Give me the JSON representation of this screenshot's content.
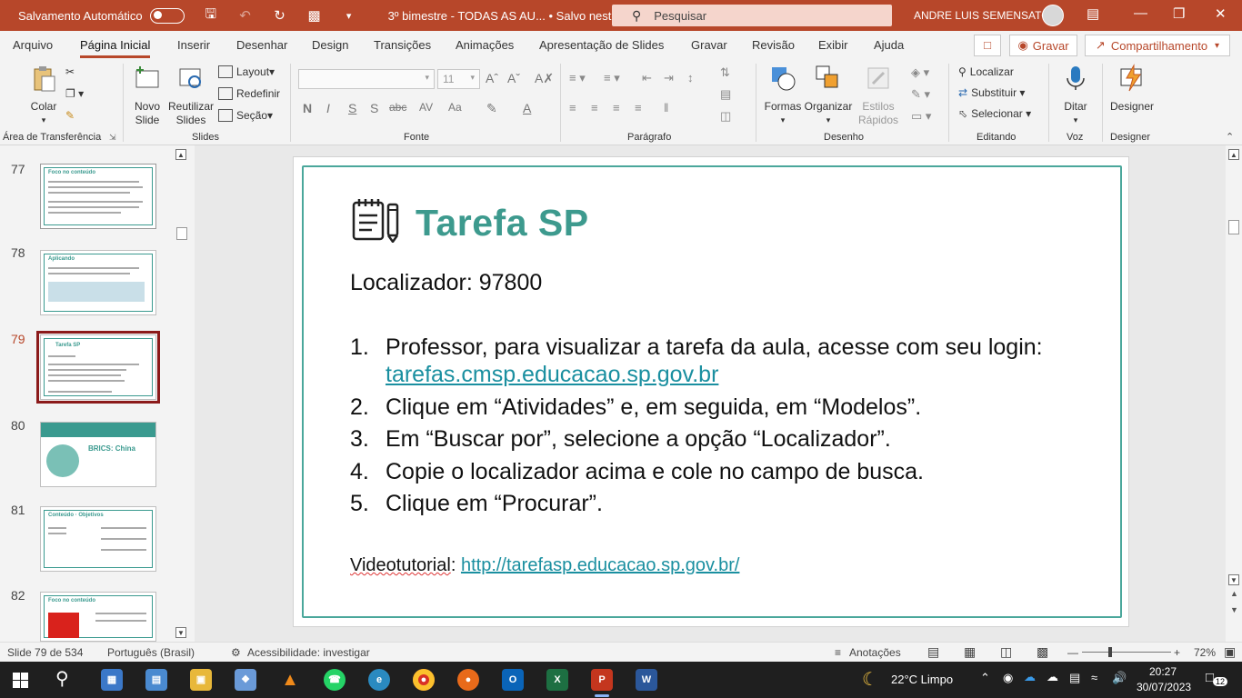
{
  "titlebar": {
    "autosave_label": "Salvamento Automático",
    "doc_title": "3º bimestre - TODAS AS AU... • Salvo neste PC",
    "search_placeholder": "Pesquisar",
    "user_name": "ANDRE LUIS SEMENSATO"
  },
  "menu": {
    "tabs": [
      "Arquivo",
      "Página Inicial",
      "Inserir",
      "Desenhar",
      "Design",
      "Transições",
      "Animações",
      "Apresentação de Slides",
      "Gravar",
      "Revisão",
      "Exibir",
      "Ajuda"
    ],
    "record_label": "Gravar",
    "share_label": "Compartilhamento"
  },
  "ribbon": {
    "clipboard": {
      "paste": "Colar",
      "group": "Área de Transferência"
    },
    "slides": {
      "new_slide": "Novo Slide",
      "reuse": "Reutilizar Slides",
      "layout": "Layout",
      "reset": "Redefinir",
      "section": "Seção",
      "group": "Slides"
    },
    "font": {
      "size": "11",
      "group": "Fonte"
    },
    "paragraph": {
      "group": "Parágrafo"
    },
    "drawing": {
      "shapes": "Formas",
      "arrange": "Organizar",
      "quick_styles": "Estilos Rápidos",
      "group": "Desenho"
    },
    "editing": {
      "find": "Localizar",
      "replace": "Substituir",
      "select": "Selecionar",
      "group": "Editando"
    },
    "voice": {
      "dictate": "Ditar",
      "group": "Voz"
    },
    "designer": {
      "label": "Designer",
      "group": "Designer"
    }
  },
  "thumbnails": [
    {
      "num": "77",
      "title": "Foco no conteúdo"
    },
    {
      "num": "78",
      "title": "Aplicando"
    },
    {
      "num": "79",
      "title": "Tarefa SP"
    },
    {
      "num": "80",
      "title": "BRICS: China"
    },
    {
      "num": "81",
      "title": "Conteúdo · Objetivos"
    },
    {
      "num": "82",
      "title": "Foco no conteúdo"
    }
  ],
  "slide": {
    "title": "Tarefa SP",
    "locator": "Localizador: 97800",
    "steps": [
      {
        "num": "1.",
        "text": "Professor, para visualizar a tarefa da aula, acesse com seu login: ",
        "link": "tarefas.cmsp.educacao.sp.gov.br"
      },
      {
        "num": "2.",
        "text": "Clique em “Atividades” e, em seguida, em “Modelos”."
      },
      {
        "num": "3.",
        "text": "Em “Buscar por”, selecione a opção “Localizador”."
      },
      {
        "num": "4.",
        "text": "Copie o localizador acima e cole no campo de busca."
      },
      {
        "num": "5.",
        "text": "Clique em “Procurar”."
      }
    ],
    "video_label": "Videotutorial",
    "video_link": "http://tarefasp.educacao.sp.gov.br/"
  },
  "status": {
    "slide_info": "Slide 79 de 534",
    "language": "Português (Brasil)",
    "accessibility": "Acessibilidade: investigar",
    "notes": "Anotações",
    "zoom": "72%"
  },
  "taskbar": {
    "weather": "22°C  Limpo",
    "time": "20:27",
    "date": "30/07/2023",
    "notifications": "12"
  },
  "colors": {
    "accent": "#b7472a",
    "teal": "#3d9a8e",
    "link": "#1a8fa0"
  }
}
